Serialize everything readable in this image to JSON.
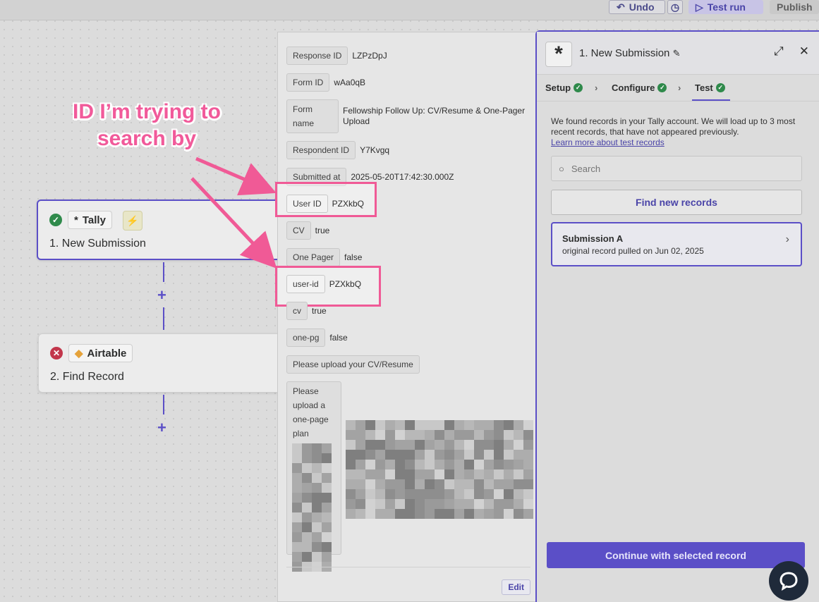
{
  "toolbar": {
    "undo_label": "Undo",
    "test_run_label": "Test run",
    "publish_label": "Publish"
  },
  "annotation": {
    "line1": "ID I’m trying to",
    "line2": "search by"
  },
  "canvas": {
    "step1": {
      "app": "Tally",
      "title": "1. New Submission"
    },
    "step2": {
      "app": "Airtable",
      "title": "2. Find Record"
    }
  },
  "record_fields": [
    {
      "key": "Response ID",
      "value": "LZPzDpJ"
    },
    {
      "key": "Form ID",
      "value": "wAa0qB"
    },
    {
      "key": "Form name",
      "value": "Fellowship Follow Up: CV/Resume & One-Pager Upload"
    },
    {
      "key": "Respondent ID",
      "value": "Y7Kvgq"
    },
    {
      "key": "Submitted at",
      "value": "2025-05-20T17:42:30.000Z"
    },
    {
      "key": "User ID",
      "value": "PZXkbQ"
    },
    {
      "key": "CV",
      "value": "true"
    },
    {
      "key": "One Pager",
      "value": "false"
    },
    {
      "key": "user-id",
      "value": "PZXkbQ"
    },
    {
      "key": "cv",
      "value": "true"
    },
    {
      "key": "one-pg",
      "value": "false"
    },
    {
      "key": "Please upload your CV/Resume",
      "value": ""
    },
    {
      "key": "Please upload a one-page plan",
      "value": ""
    }
  ],
  "middle_panel": {
    "edit_label": "Edit"
  },
  "right_panel": {
    "title": "1. New Submission",
    "tabs": [
      "Setup",
      "Configure",
      "Test"
    ],
    "description": "We found records in your Tally account. We will load up to 3 most recent records, that have not appeared previously.",
    "learn_more": "Learn more about test records",
    "search_placeholder": "Search",
    "find_button": "Find new records",
    "record": {
      "title": "Submission A",
      "subtitle": "original record pulled on Jun 02, 2025"
    },
    "continue_button": "Continue with selected record"
  },
  "colors": {
    "accent": "#5b4fc7",
    "highlight": "#f05a96",
    "success": "#2f8a4b",
    "error": "#c2364b"
  }
}
